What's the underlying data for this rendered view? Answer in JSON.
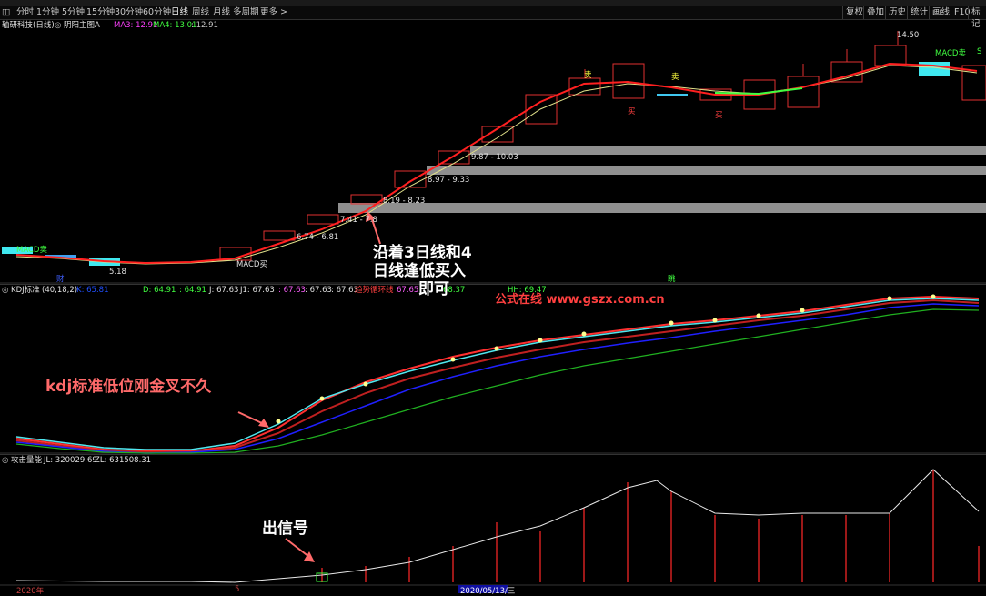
{
  "toolbar": {
    "periods": [
      "分时",
      "1分钟",
      "5分钟",
      "15分钟",
      "30分钟",
      "60分钟",
      "日线",
      "周线",
      "月线",
      "多周期",
      "更多 >"
    ],
    "active_period": "日线",
    "right_buttons": [
      "复权",
      "叠加",
      "历史",
      "统计",
      "画线",
      "F10",
      "标记"
    ]
  },
  "main_header": {
    "stock": "轴研科技(日线)",
    "indicator": "阴阳主图A",
    "ma3": "MA3: 12.91",
    "ma4": "MA4: 13.01",
    "val": ": 12.91"
  },
  "kdj_header": {
    "name": "KDJ标准",
    "params": "(40,18,2)",
    "k": "K: 65.81",
    "d": "D: 64.91",
    "d2": ": 64.91",
    "j": "J: 67.63",
    "j1": "J1: 67.63",
    "v1": ": 67.63",
    "v2": ": 67.63",
    "v3": ": 67.63",
    "trend": "趋势循环线",
    "v4": "67.65",
    "v5": "68.37",
    "hh": "HH: 69.47"
  },
  "vol_header": {
    "name": "攻击量能",
    "jl": "JL: 320029.69",
    "zl": "ZL: 631508.31"
  },
  "price_labels": {
    "high": "14.50",
    "low": "5.18",
    "z1": "6.74 - 6.81",
    "z2": "7.41 - 7.8",
    "z3": "8.19 - 8.23",
    "z4": "8.97 - 9.33",
    "z5": "9.87 - 10.03"
  },
  "signals": {
    "macd_sell_left": "MACD卖",
    "macd_buy": "MACD买",
    "macd_sell_right": "MACD卖",
    "sell": "卖",
    "buy": "买",
    "cai": "财",
    "tiao": "跳",
    "s": "S"
  },
  "annotations": {
    "a1_line1": "沿着3日线和4",
    "a1_line2": "日线逢低买入",
    "a1_line3": "即可",
    "watermark": "公式在线 www.gszx.com.cn",
    "a2": "kdj标准低位刚金叉不久",
    "a3": "出信号"
  },
  "x_axis": {
    "start": "2020年",
    "mid": "5",
    "date": "2020/05/13/三"
  },
  "colors": {
    "ma_red": "#ff2020",
    "ma_yellow": "#e0e08a",
    "macd_cyan": "#50e8f0",
    "annot_red": "#ff6a6a",
    "annot_white": "#ffffff"
  }
}
